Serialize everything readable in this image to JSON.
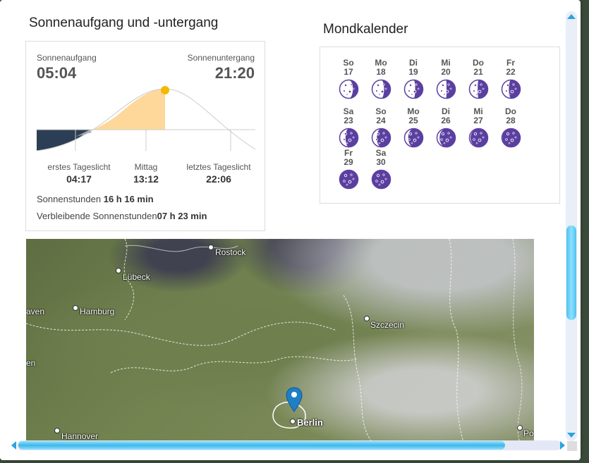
{
  "sun": {
    "title": "Sonnenaufgang und -untergang",
    "sunrise_label": "Sonnenaufgang",
    "sunrise_time": "05:04",
    "sunset_label": "Sonnenuntergang",
    "sunset_time": "21:20",
    "first_light_label": "erstes Tageslicht",
    "first_light_time": "04:17",
    "noon_label": "Mittag",
    "noon_time": "13:12",
    "last_light_label": "letztes Tageslicht",
    "last_light_time": "22:06",
    "hours_label": "Sonnenstunden",
    "hours_value": "16 h 16 min",
    "remaining_label": "Verbleibende Sonnenstunden",
    "remaining_value": "07 h 23 min",
    "colors": {
      "day": "#fdd89a",
      "night": "#2c3e55",
      "sun": "#f5b800"
    }
  },
  "moon": {
    "title": "Mondkalender",
    "color": "#5b3fa0",
    "days": [
      {
        "d": "So",
        "n": "17",
        "phase": 0.28
      },
      {
        "d": "Mo",
        "n": "18",
        "phase": 0.35
      },
      {
        "d": "Di",
        "n": "19",
        "phase": 0.42
      },
      {
        "d": "Mi",
        "n": "20",
        "phase": 0.48
      },
      {
        "d": "Do",
        "n": "21",
        "phase": 0.55
      },
      {
        "d": "Fr",
        "n": "22",
        "phase": 0.62
      },
      {
        "d": "Sa",
        "n": "23",
        "phase": 0.68
      },
      {
        "d": "So",
        "n": "24",
        "phase": 0.74
      },
      {
        "d": "Mo",
        "n": "25",
        "phase": 0.8
      },
      {
        "d": "Di",
        "n": "26",
        "phase": 0.86
      },
      {
        "d": "Mi",
        "n": "27",
        "phase": 0.94
      },
      {
        "d": "Do",
        "n": "28",
        "phase": 0.97
      },
      {
        "d": "Fr",
        "n": "29",
        "phase": 1.0
      },
      {
        "d": "Sa",
        "n": "30",
        "phase": 1.0
      }
    ]
  },
  "map": {
    "cities": [
      {
        "name": "Rostock",
        "bold": false
      },
      {
        "name": "Lübeck",
        "bold": false
      },
      {
        "name": "aven",
        "bold": false
      },
      {
        "name": "Hamburg",
        "bold": false
      },
      {
        "name": "Szczecin",
        "bold": false
      },
      {
        "name": "en",
        "bold": false
      },
      {
        "name": "Berlin",
        "bold": true
      },
      {
        "name": "Hannover",
        "bold": false
      },
      {
        "name": "Po",
        "bold": false
      }
    ]
  }
}
